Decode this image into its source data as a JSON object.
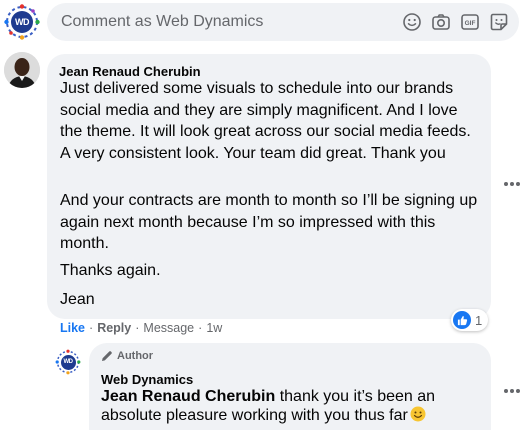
{
  "composer": {
    "placeholder": "Comment as Web Dynamics",
    "avatar_initials": "WD",
    "icons": [
      "emoji-icon",
      "camera-icon",
      "gif-icon",
      "sticker-icon"
    ]
  },
  "comment": {
    "author": "Jean Renaud Cherubin",
    "paragraphs": [
      "Just delivered some visuals to schedule into our brands social media and they are simply magnificent. And I love the theme. It will look great across our social media feeds. A very consistent look. Your team did great. Thank you",
      "And your contracts are month to month so I’ll be signing up again next month because I’m so impressed with this month.",
      "Thanks again.",
      "Jean"
    ],
    "reaction_count": "1",
    "actions": {
      "like": "Like",
      "reply": "Reply",
      "message": "Message",
      "time": "1w",
      "separator": "·"
    }
  },
  "reply": {
    "badge": "Author",
    "author": "Web Dynamics",
    "avatar_initials": "WD",
    "mention": "Jean Renaud Cherubin",
    "text": " thank you it’s been an absolute pleasure working with you thus far"
  },
  "colors": {
    "bubble": "#f0f2f5",
    "link_blue": "#1877f2",
    "muted": "#65676b",
    "logo_blue": "#1f3b8f"
  }
}
